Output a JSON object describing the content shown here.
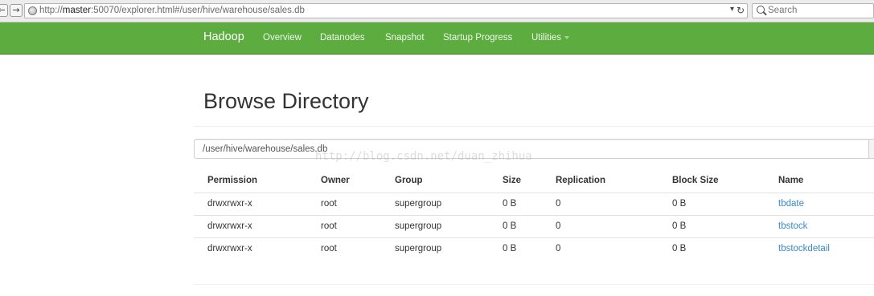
{
  "browser": {
    "url_scheme_prefix": "http://",
    "url_host": "master",
    "url_rest": ":50070/explorer.html#/user/hive/warehouse/sales.db",
    "search_placeholder": "Search"
  },
  "navbar": {
    "brand": "Hadoop",
    "items": [
      {
        "label": "Overview"
      },
      {
        "label": "Datanodes"
      },
      {
        "label": "Snapshot"
      },
      {
        "label": "Startup Progress"
      },
      {
        "label": "Utilities"
      }
    ],
    "background_color": "#5cac3f"
  },
  "page": {
    "title": "Browse Directory",
    "path_value": "/user/hive/warehouse/sales.db",
    "watermark": "http://blog.csdn.net/duan_zhihua"
  },
  "table": {
    "headers": [
      "Permission",
      "Owner",
      "Group",
      "Size",
      "Replication",
      "Block Size",
      "Name"
    ],
    "rows": [
      {
        "permission": "drwxrwxr-x",
        "owner": "root",
        "group": "supergroup",
        "size": "0 B",
        "replication": "0",
        "block_size": "0 B",
        "name": "tbdate"
      },
      {
        "permission": "drwxrwxr-x",
        "owner": "root",
        "group": "supergroup",
        "size": "0 B",
        "replication": "0",
        "block_size": "0 B",
        "name": "tbstock"
      },
      {
        "permission": "drwxrwxr-x",
        "owner": "root",
        "group": "supergroup",
        "size": "0 B",
        "replication": "0",
        "block_size": "0 B",
        "name": "tbstockdetail"
      }
    ],
    "link_color": "#3a8ac8"
  }
}
